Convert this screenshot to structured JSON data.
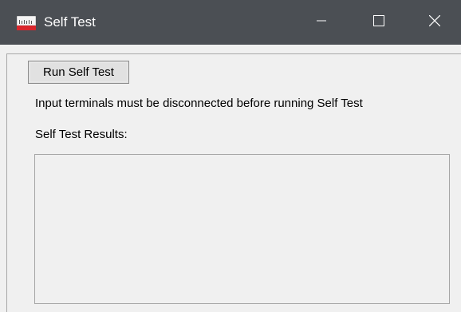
{
  "window": {
    "title": "Self Test",
    "titlebar_color": "#4b4f54",
    "app_icon": "meter-icon",
    "controls": {
      "minimize_icon": "minimize-icon",
      "maximize_icon": "maximize-icon",
      "close_icon": "close-icon"
    }
  },
  "main": {
    "run_button_label": "Run Self Test",
    "instruction": "Input terminals must be disconnected before running Self Test",
    "results_label": "Self Test Results:",
    "results_value": ""
  }
}
